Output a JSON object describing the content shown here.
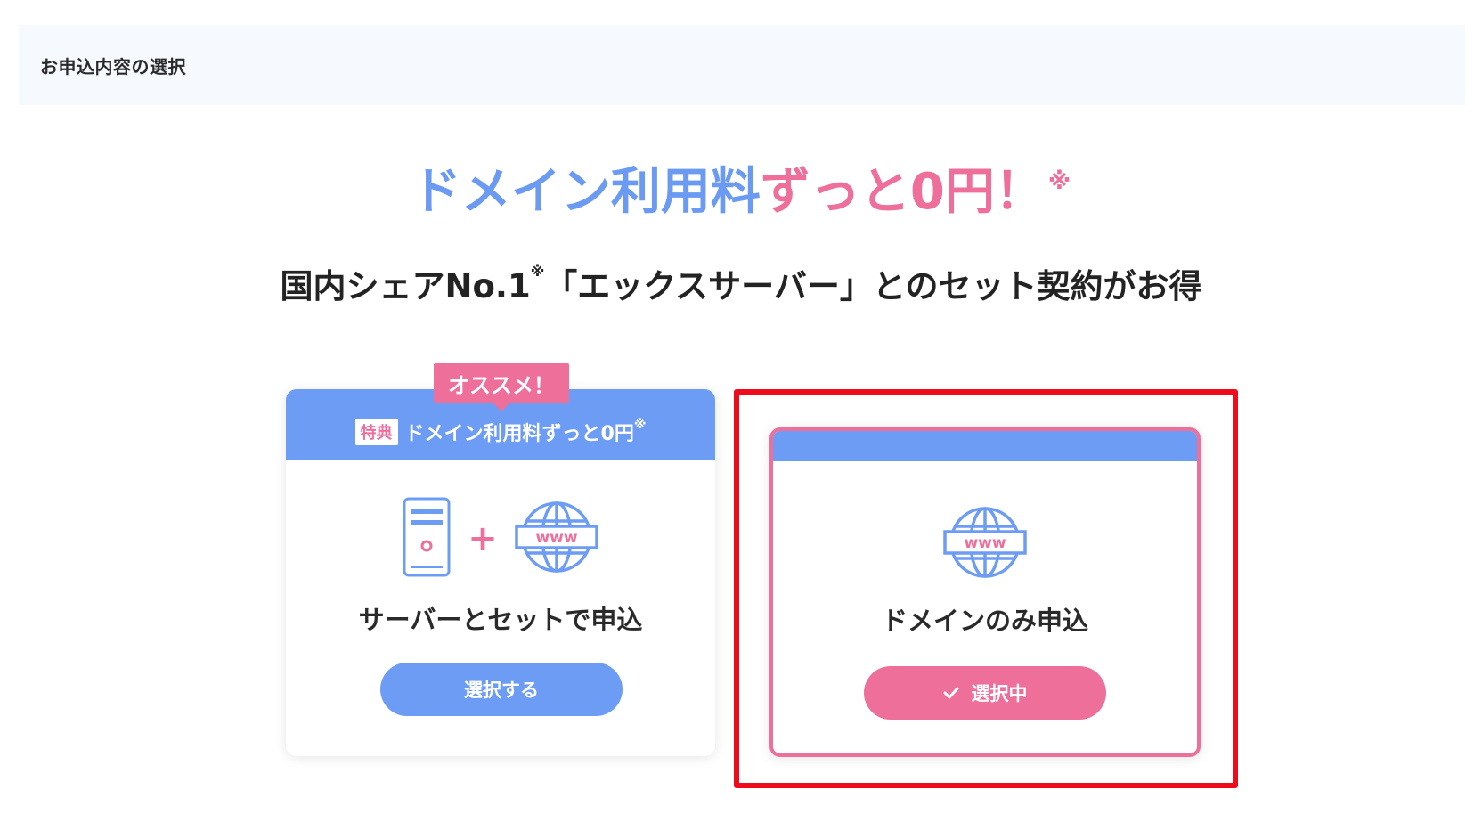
{
  "header": {
    "title": "お申込内容の選択"
  },
  "headline": {
    "part_blue": "ドメイン利用料",
    "part_pink": "ずっと0円！",
    "note_mark": "※"
  },
  "subheadline": {
    "text_before": "国内シェアNo.1",
    "note_mark": "※",
    "text_after": "「エックスサーバー」とのセット契約がお得"
  },
  "cards": {
    "server_set": {
      "recommend_tag": "オススメ！",
      "badge": "特典",
      "band_text": "ドメイン利用料ずっと0円",
      "band_note_mark": "※",
      "plus_symbol": "+",
      "www_label": "www",
      "label": "サーバーとセットで申込",
      "button_label": "選択する",
      "selected": false
    },
    "domain_only": {
      "www_label": "www",
      "label": "ドメインのみ申込",
      "button_label": "選択中",
      "selected": true
    }
  },
  "icons": {
    "server": "server-icon",
    "globe": "globe-www-icon",
    "check": "check-icon"
  },
  "colors": {
    "blue": "#6d9cf4",
    "pink": "#ee6f9a",
    "highlight_red": "#ef0a1c",
    "header_bg": "#f6f9fe"
  }
}
